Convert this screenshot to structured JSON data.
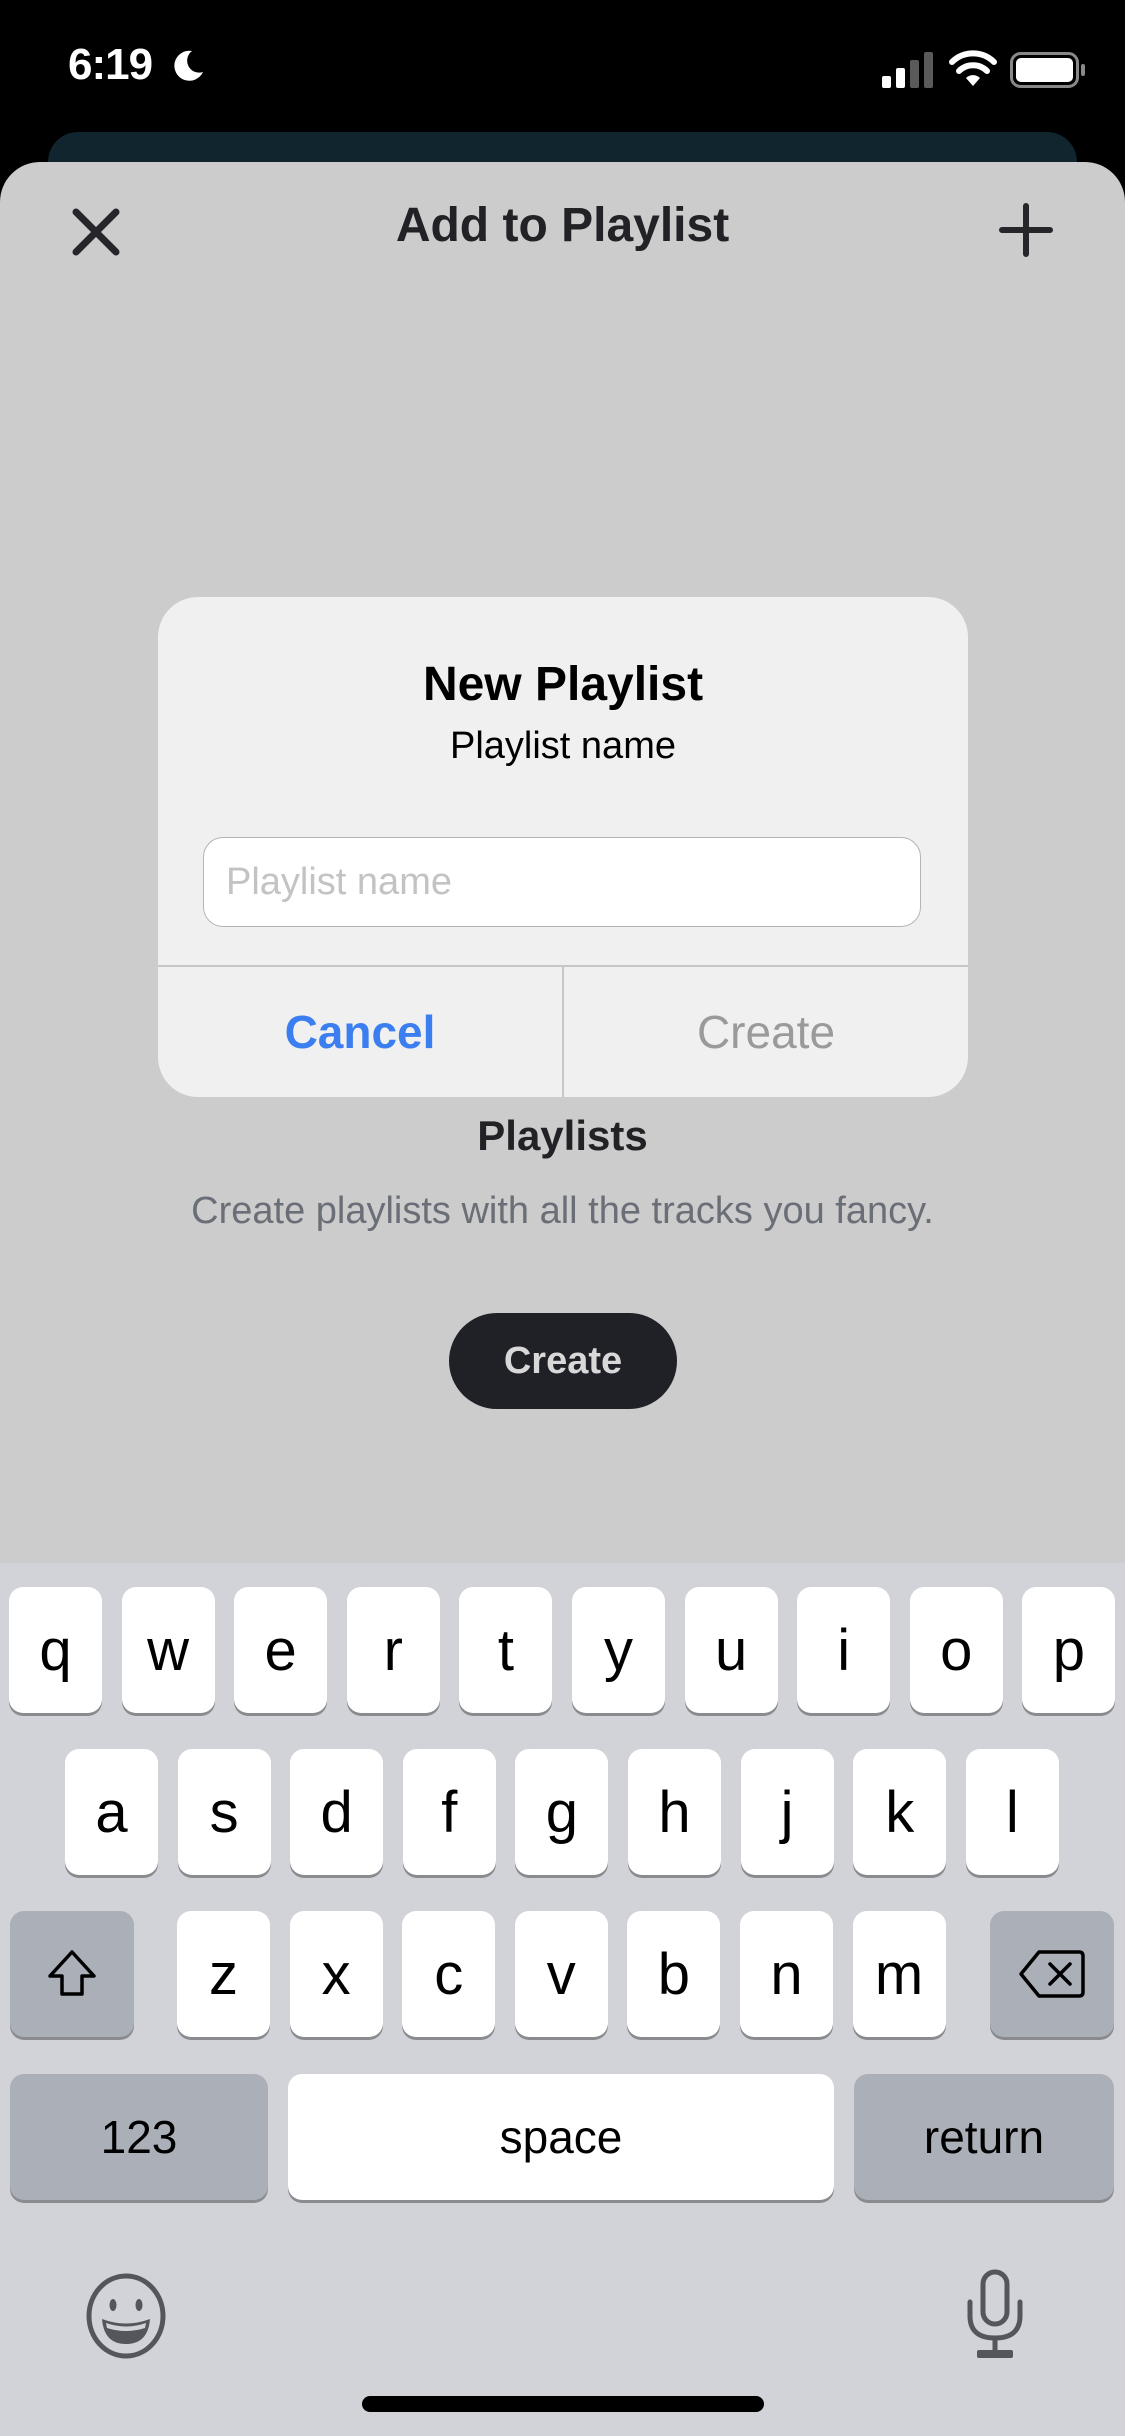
{
  "status_bar": {
    "time": "6:19",
    "focus_icon": "moon-icon",
    "signal_icon": "cellular-signal-icon",
    "wifi_icon": "wifi-icon",
    "battery_icon": "battery-icon"
  },
  "sheet": {
    "title": "Add to Playlist",
    "close_icon": "close-icon",
    "add_icon": "plus-icon"
  },
  "empty_state": {
    "title": "Playlists",
    "description": "Create playlists with all the tracks you fancy.",
    "create_label": "Create"
  },
  "alert": {
    "title": "New Playlist",
    "message": "Playlist name",
    "input_value": "",
    "input_placeholder": "Playlist name",
    "cancel_label": "Cancel",
    "create_label": "Create",
    "colors": {
      "cancel": "#3b7ef0",
      "create_disabled": "#9a9a9a"
    }
  },
  "keyboard": {
    "row1": [
      "q",
      "w",
      "e",
      "r",
      "t",
      "y",
      "u",
      "i",
      "o",
      "p"
    ],
    "row2": [
      "a",
      "s",
      "d",
      "f",
      "g",
      "h",
      "j",
      "k",
      "l"
    ],
    "row3": [
      "z",
      "x",
      "c",
      "v",
      "b",
      "n",
      "m"
    ],
    "shift_icon": "shift-icon",
    "delete_icon": "backspace-icon",
    "numbers_label": "123",
    "space_label": "space",
    "return_label": "return",
    "emoji_icon": "emoji-icon",
    "mic_icon": "microphone-icon"
  }
}
